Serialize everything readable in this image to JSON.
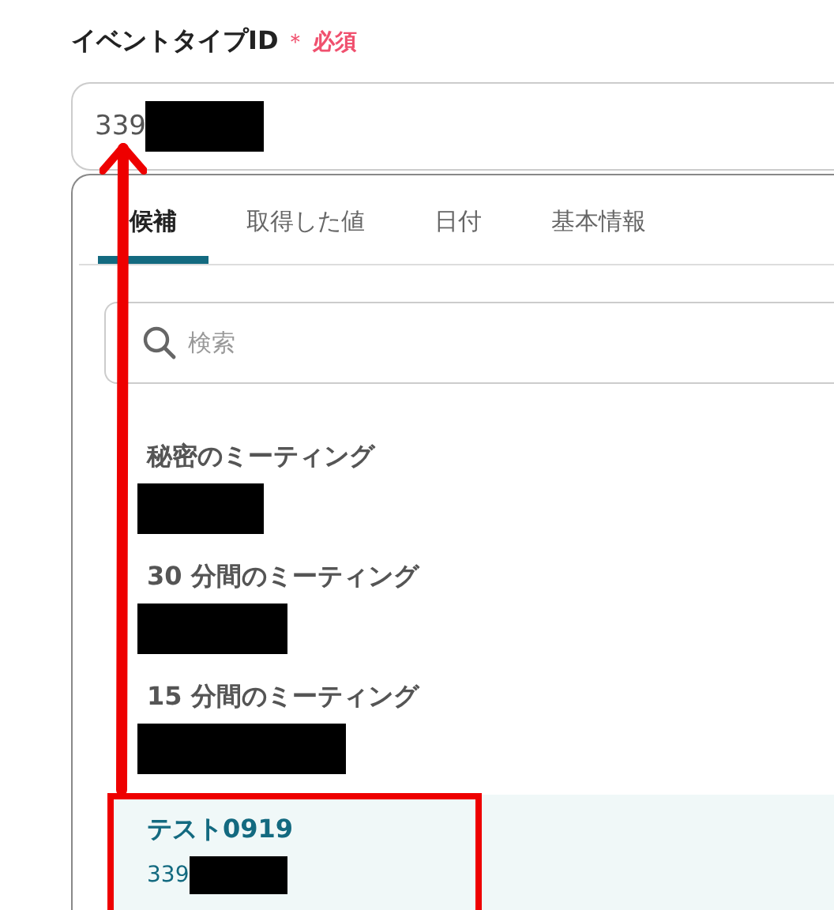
{
  "field": {
    "label": "イベントタイプID",
    "required_mark": "＊",
    "required_text": "必須",
    "value": "339"
  },
  "tabs": [
    {
      "label": "候補",
      "selected": true
    },
    {
      "label": "取得した値",
      "selected": false
    },
    {
      "label": "日付",
      "selected": false
    },
    {
      "label": "基本情報",
      "selected": false
    }
  ],
  "search": {
    "placeholder": "検索"
  },
  "options": [
    {
      "title": "秘密のミーティング",
      "selected": false
    },
    {
      "title": "30 分間のミーティング",
      "selected": false
    },
    {
      "title": "15 分間のミーティング",
      "selected": false
    },
    {
      "title": "テスト0919",
      "value": "339",
      "selected": true
    }
  ]
}
